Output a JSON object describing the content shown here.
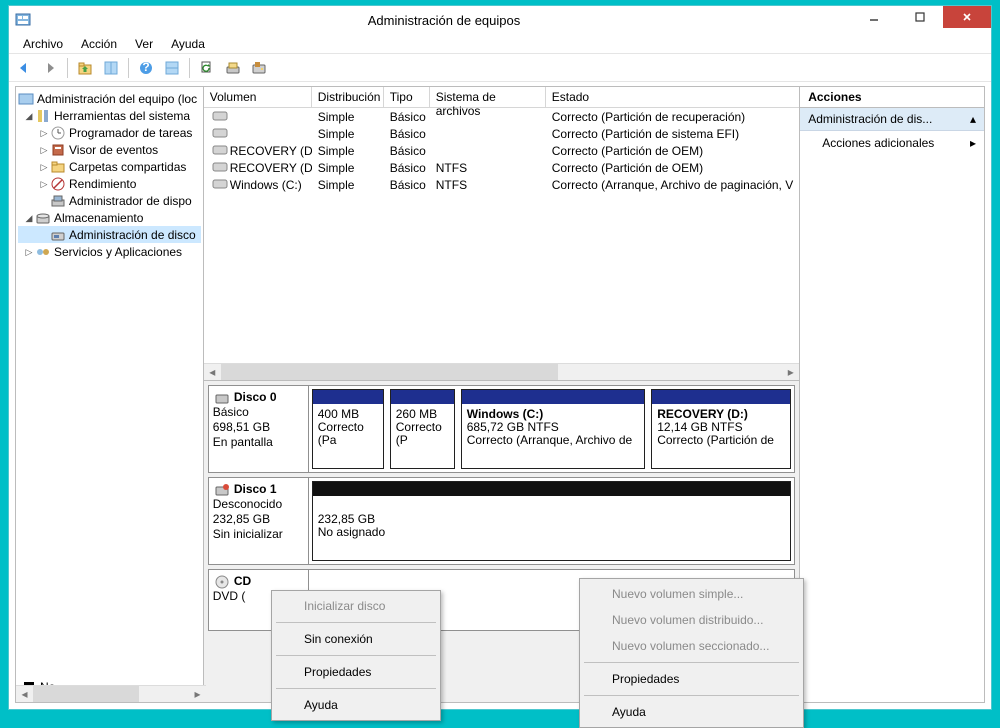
{
  "titlebar": {
    "title": "Administración de equipos"
  },
  "menu": {
    "archivo": "Archivo",
    "accion": "Acción",
    "ver": "Ver",
    "ayuda": "Ayuda"
  },
  "tree": {
    "root": "Administración del equipo (loc",
    "tools": "Herramientas del sistema",
    "progtareas": "Programador de tareas",
    "visor": "Visor de eventos",
    "carpetas": "Carpetas compartidas",
    "rendimiento": "Rendimiento",
    "admdisp": "Administrador de dispo",
    "almacen": "Almacenamiento",
    "admdiscos": "Administración de disco",
    "servicios": "Servicios y Aplicaciones"
  },
  "cols": {
    "volumen": "Volumen",
    "distribucion": "Distribución",
    "tipo": "Tipo",
    "sistema": "Sistema de archivos",
    "estado": "Estado"
  },
  "rows": [
    {
      "vol": "",
      "dist": "Simple",
      "tipo": "Básico",
      "fs": "",
      "estado": "Correcto (Partición de recuperación)"
    },
    {
      "vol": "",
      "dist": "Simple",
      "tipo": "Básico",
      "fs": "",
      "estado": "Correcto (Partición de sistema EFI)"
    },
    {
      "vol": "RECOVERY (D:)",
      "dist": "Simple",
      "tipo": "Básico",
      "fs": "",
      "estado": "Correcto (Partición de OEM)"
    },
    {
      "vol": "RECOVERY (D:)",
      "dist": "Simple",
      "tipo": "Básico",
      "fs": "NTFS",
      "estado": "Correcto (Partición de OEM)"
    },
    {
      "vol": "Windows (C:)",
      "dist": "Simple",
      "tipo": "Básico",
      "fs": "NTFS",
      "estado": "Correcto (Arranque, Archivo de paginación, V"
    }
  ],
  "disk0": {
    "name": "Disco 0",
    "type": "Básico",
    "size": "698,51 GB",
    "status": "En pantalla",
    "p1_size": "400 MB",
    "p1_status": "Correcto (Pa",
    "p2_size": "260 MB",
    "p2_status": "Correcto (P",
    "p3_name": "Windows  (C:)",
    "p3_size": "685,72 GB NTFS",
    "p3_status": "Correcto (Arranque, Archivo de",
    "p4_name": "RECOVERY  (D:)",
    "p4_size": "12,14 GB NTFS",
    "p4_status": "Correcto (Partición de"
  },
  "disk1": {
    "name": "Disco 1",
    "type": "Desconocido",
    "size": "232,85 GB",
    "status": "Sin inicializar",
    "p1_size": "232,85 GB",
    "p1_status": "No asignado"
  },
  "cdrom": {
    "name": "CD",
    "type": "DVD ("
  },
  "legend": {
    "label": "No "
  },
  "actions": {
    "header": "Acciones",
    "sub": "Administración de dis...",
    "more": "Acciones adicionales"
  },
  "ctx1": {
    "init": "Inicializar disco",
    "offline": "Sin conexión",
    "prop": "Propiedades",
    "help": "Ayuda"
  },
  "ctx2": {
    "simple": "Nuevo volumen simple...",
    "dist": "Nuevo volumen distribuido...",
    "secc": "Nuevo volumen seccionado...",
    "prop": "Propiedades",
    "help": "Ayuda"
  }
}
